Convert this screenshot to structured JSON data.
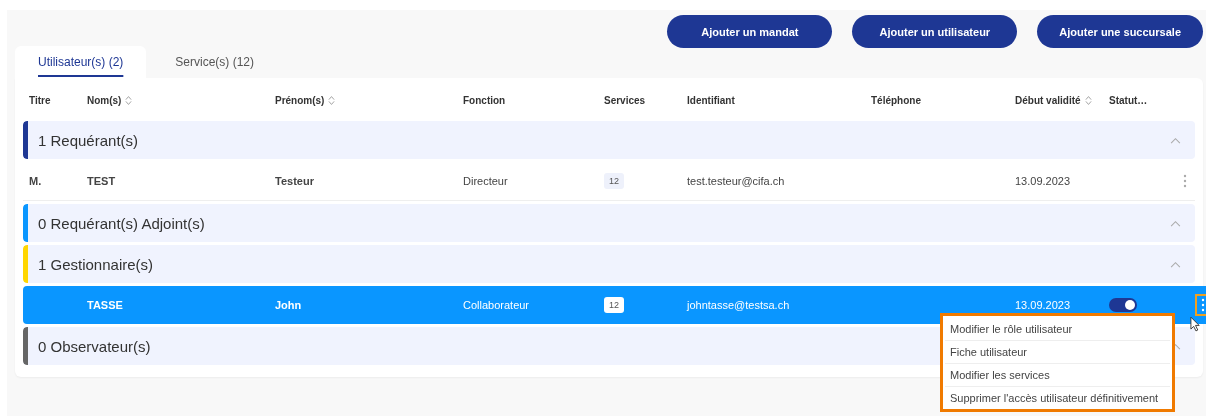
{
  "actions": [
    "Ajouter un mandat",
    "Ajouter un utilisateur",
    "Ajouter une succursale"
  ],
  "tabs": [
    {
      "label": "Utilisateur(s) (2)",
      "selected": true
    },
    {
      "label": "Service(s) (12)",
      "selected": false
    }
  ],
  "columns": [
    {
      "label": "Titre",
      "sortable": false
    },
    {
      "label": "Nom(s)",
      "sortable": true
    },
    {
      "label": "Prénom(s)",
      "sortable": true
    },
    {
      "label": "Fonction",
      "sortable": false
    },
    {
      "label": "Services",
      "sortable": false
    },
    {
      "label": "Identifiant",
      "sortable": false
    },
    {
      "label": "Téléphone",
      "sortable": false
    },
    {
      "label": "Début validité",
      "sortable": true
    },
    {
      "label": "Statut…",
      "sortable": false
    }
  ],
  "groups": [
    {
      "label": "1 Requérant(s)",
      "color": "#1e3794",
      "rows": [
        {
          "title": "M.",
          "name": "TEST",
          "first_name": "Testeur",
          "function": "Directeur",
          "services": "12",
          "identifiant": "test.testeur@cifa.ch",
          "start": "13.09.2023",
          "selected": false
        }
      ]
    },
    {
      "label": "0 Requérant(s) Adjoint(s)",
      "color": "#0a96ff"
    },
    {
      "label": "1 Gestionnaire(s)",
      "color": "#ffd600",
      "rows": [
        {
          "name": "TASSE",
          "first_name": "John",
          "function": "Collaborateur",
          "services": "12",
          "identifiant": "johntasse@testsa.ch",
          "start": "13.09.2023",
          "selected": true,
          "status": {
            "on": true
          }
        }
      ]
    },
    {
      "label": "0 Observateur(s)",
      "color": "#666666"
    }
  ],
  "context_menu": [
    "Modifier le rôle utilisateur",
    "Fiche utilisateur",
    "Modifier les services",
    "Supprimer l'accès utilisateur définitivement"
  ]
}
